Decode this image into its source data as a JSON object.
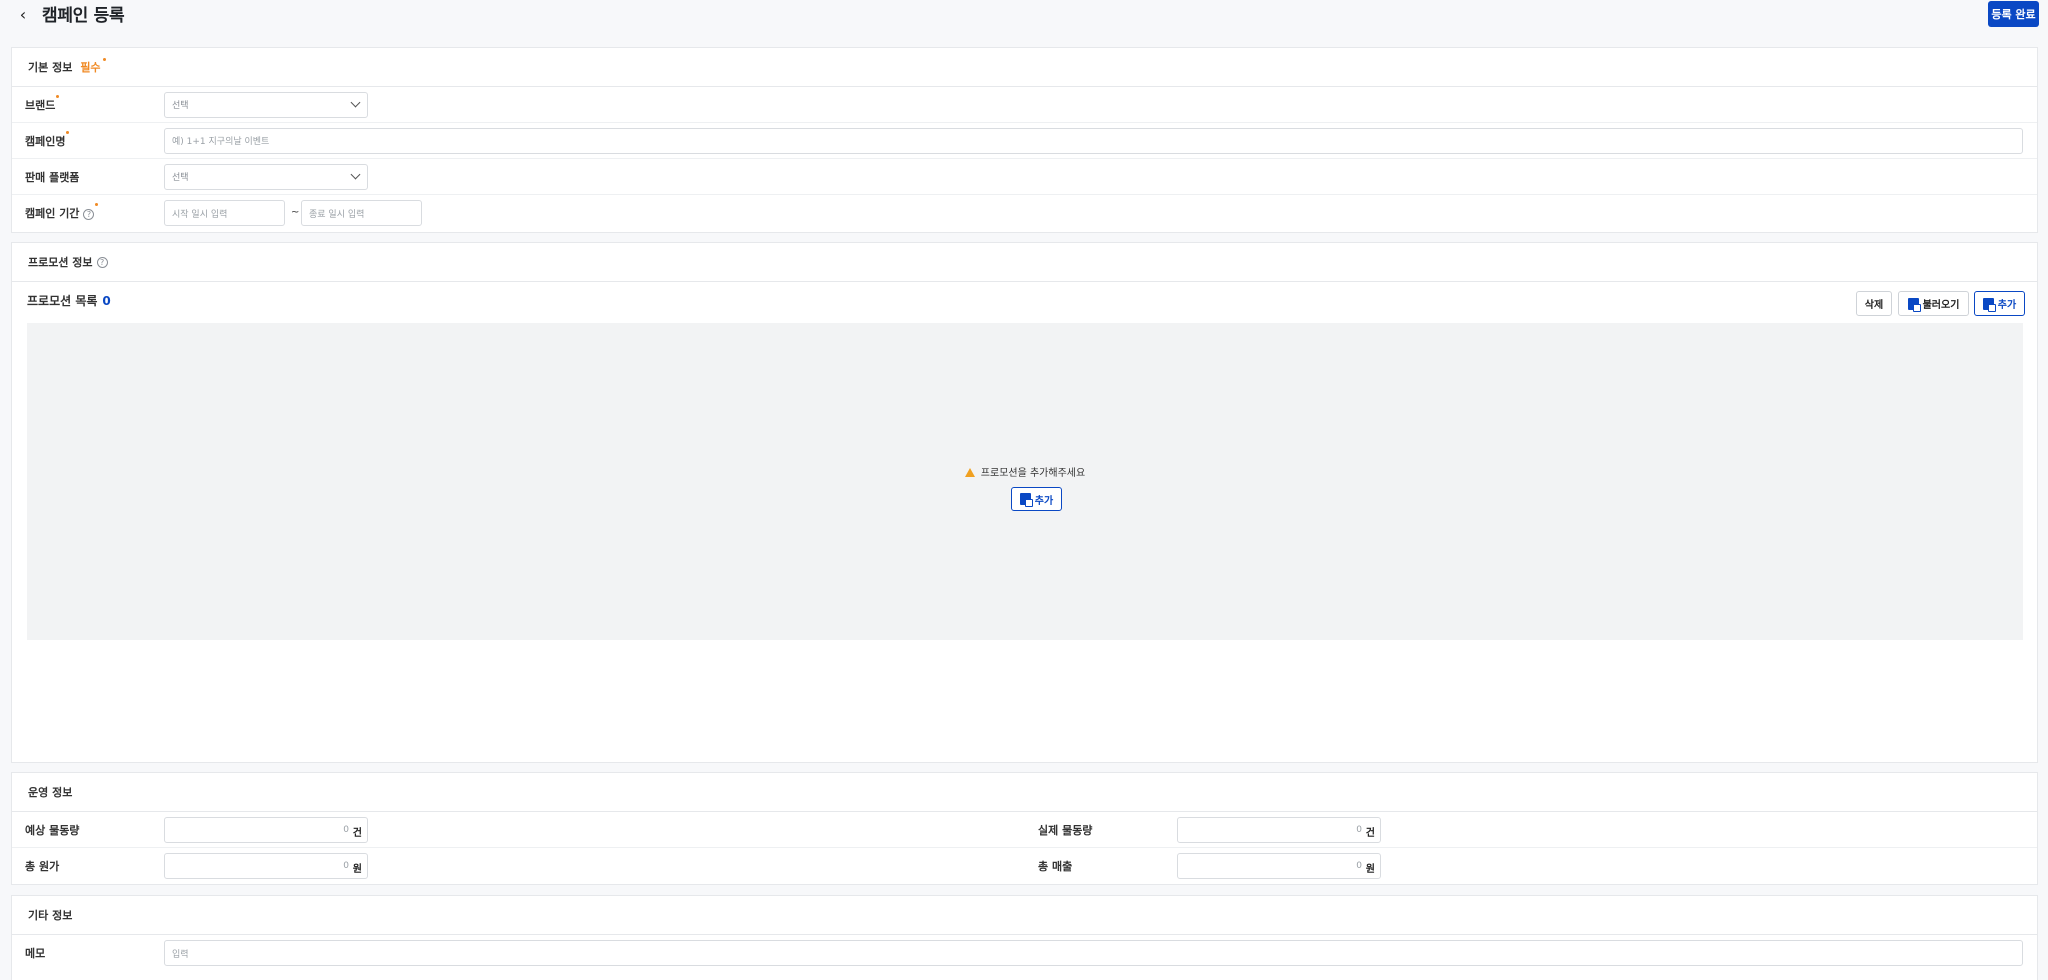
{
  "header": {
    "title": "캠페인 등록",
    "submit": "등록 완료"
  },
  "basic": {
    "title": "기본 정보",
    "required_tag": "필수",
    "brand": {
      "label": "브랜드",
      "value": "선택"
    },
    "campaign_name": {
      "label": "캠페인명",
      "placeholder": "예) 1+1 지구의날 이벤트"
    },
    "platform": {
      "label": "판매 플랫폼",
      "value": "선택"
    },
    "period": {
      "label": "캠페인 기간",
      "start": "시작 일시 입력",
      "separator": "~",
      "end": "종료 일시 입력"
    }
  },
  "promotion": {
    "title": "프로모션 정보",
    "list_title": "프로모션 목록",
    "count": "0",
    "delete": "삭제",
    "load": "불러오기",
    "add": "추가",
    "empty_message": "프로모션을 추가해주세요",
    "empty_add": "추가"
  },
  "operation": {
    "title": "운영 정보",
    "expected_volume": {
      "label": "예상 물동량",
      "value": "0",
      "unit": "건"
    },
    "actual_volume": {
      "label": "실제 물동량",
      "value": "0",
      "unit": "건"
    },
    "total_cost": {
      "label": "총 원가",
      "value": "0",
      "unit": "원"
    },
    "total_sales": {
      "label": "총 매출",
      "value": "0",
      "unit": "원"
    }
  },
  "etc": {
    "title": "기타 정보",
    "memo": {
      "label": "메모",
      "placeholder": "입력"
    }
  },
  "colors": {
    "primary": "#0a48c4",
    "required": "#f08a24",
    "warning": "#f0a020"
  }
}
